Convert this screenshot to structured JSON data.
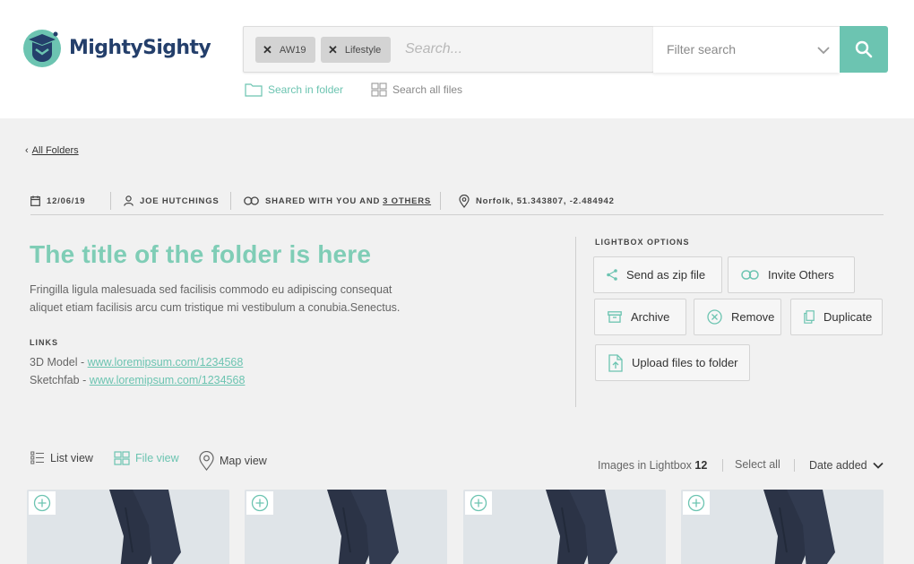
{
  "brand": {
    "name": "MightySighty",
    "accent": "#6cc4b1",
    "navy": "#243f6b"
  },
  "search": {
    "chips": [
      {
        "label": "AW19"
      },
      {
        "label": "Lifestyle"
      }
    ],
    "placeholder": "Search...",
    "filter_label": "Filter search",
    "scopes": [
      {
        "label": "Search in folder",
        "active": true
      },
      {
        "label": "Search all files",
        "active": false
      }
    ]
  },
  "breadcrumb": {
    "label": "All Folders"
  },
  "meta": {
    "date": "12/06/19",
    "owner": "JOE HUTCHINGS",
    "shared_prefix": "SHARED WITH YOU AND",
    "shared_link": "3 OTHERS",
    "location": "Norfolk, 51.343807, -2.484942"
  },
  "folder": {
    "title": "The title of the folder is here",
    "description_line1": "Fringilla ligula malesuada sed facilisis commodo eu adipiscing consequat",
    "description_line2": "aliquet etiam facilisis arcu cum tristique mi vestibulum a conubia.Senectus.",
    "links_label": "LINKS",
    "links": [
      {
        "label": "3D Model -",
        "url": "www.loremipsum.com/1234568"
      },
      {
        "label": "Sketchfab -",
        "url": "www.loremipsum.com/1234568"
      }
    ]
  },
  "lightbox": {
    "label": "LIGHTBOX OPTIONS",
    "options": {
      "send_zip": "Send as zip file",
      "invite": "Invite Others",
      "archive": "Archive",
      "remove": "Remove",
      "duplicate": "Duplicate",
      "upload": "Upload files to folder"
    }
  },
  "views": {
    "list": "List view",
    "file": "File view",
    "map": "Map view",
    "active": "file"
  },
  "gallery": {
    "count_label": "Images in Lightbox",
    "count": "12",
    "select_all": "Select all",
    "sort": "Date added"
  }
}
